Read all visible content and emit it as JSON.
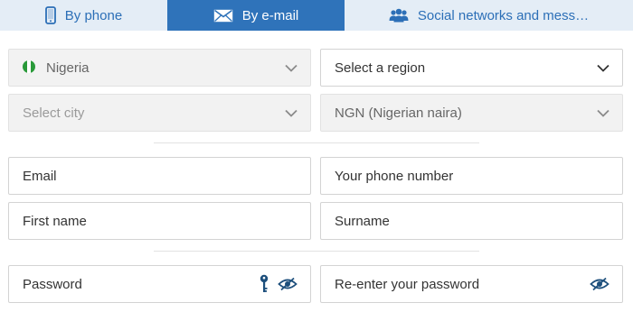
{
  "tabs": {
    "phone": {
      "label": "By phone",
      "icon": "smartphone-icon"
    },
    "email": {
      "label": "By e-mail",
      "icon": "envelope-icon",
      "active": true
    },
    "social": {
      "label": "Social networks and mess…",
      "icon": "people-icon"
    }
  },
  "form": {
    "country": {
      "value": "Nigeria",
      "icon": "nigeria-flag-icon"
    },
    "region": {
      "placeholder": "Select a region"
    },
    "city": {
      "placeholder": "Select city"
    },
    "currency": {
      "value": "NGN (Nigerian naira)"
    },
    "email": {
      "placeholder": "Email"
    },
    "phone": {
      "placeholder": "Your phone number"
    },
    "first_name": {
      "placeholder": "First name"
    },
    "surname": {
      "placeholder": "Surname"
    },
    "password": {
      "placeholder": "Password",
      "icons": [
        "key-icon",
        "eye-slash-icon"
      ]
    },
    "password_confirm": {
      "placeholder": "Re-enter your password",
      "icons": [
        "eye-slash-icon"
      ]
    }
  },
  "colors": {
    "tab_active_bg": "#2f73ba",
    "tab_inactive_bg": "#e4edf6",
    "accent_text": "#2c6fb7",
    "icon_dark": "#1d4f7c"
  }
}
